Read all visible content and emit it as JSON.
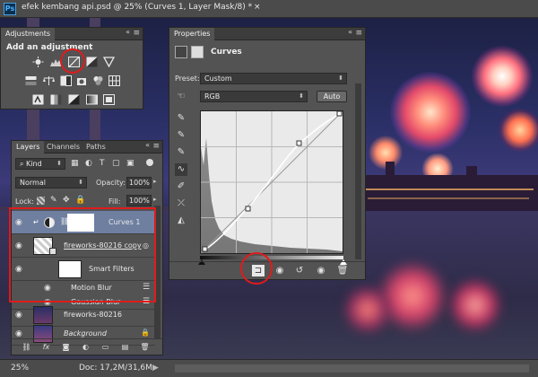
{
  "window": {
    "title": "efek kembang api.psd @ 25% (Curves 1, Layer Mask/8) *",
    "close_glyph": "×",
    "logo": "Ps"
  },
  "status_bar": {
    "zoom": "25%",
    "doc_info": "Doc: 17,2M/31,6M"
  },
  "adjustments_panel": {
    "tab_label": "Adjustments",
    "heading": "Add an adjustment",
    "icons_row1": [
      "brightness-contrast-icon",
      "levels-icon",
      "curves-icon",
      "exposure-icon",
      "vibrance-icon"
    ],
    "icons_row2": [
      "hue-saturation-icon",
      "color-balance-icon",
      "black-white-icon",
      "photo-filter-icon",
      "channel-mixer-icon",
      "color-lookup-icon"
    ],
    "icons_row3": [
      "invert-icon",
      "posterize-icon",
      "threshold-icon",
      "gradient-map-icon",
      "selective-color-icon"
    ]
  },
  "properties_panel": {
    "tab_label": "Properties",
    "title": "Curves",
    "preset_label": "Preset:",
    "preset_value": "Custom",
    "channel_value": "RGB",
    "auto_button": "Auto",
    "tools": [
      "on-image-adjust-icon",
      "sample-black-icon",
      "sample-gray-icon",
      "sample-white-icon",
      "curve-edit-icon",
      "pencil-draw-icon",
      "smooth-icon",
      "clipping-warning-icon"
    ],
    "footer_icons": [
      "clip-to-layer-icon",
      "view-previous-icon",
      "reset-icon",
      "visibility-icon",
      "delete-icon"
    ]
  },
  "layers_panel": {
    "tabs": [
      "Layers",
      "Channels",
      "Paths"
    ],
    "filter_value": "Kind",
    "blend_mode": "Normal",
    "opacity_label": "Opacity:",
    "opacity_value": "100%",
    "lock_label": "Lock:",
    "fill_label": "Fill:",
    "fill_value": "100%",
    "layers": [
      {
        "name": "Curves 1",
        "selected": true,
        "kind": "adjustment"
      },
      {
        "name": "fireworks-80216 copy",
        "selected": false,
        "kind": "smart-object"
      },
      {
        "name": "Smart Filters",
        "selected": false,
        "kind": "smart-filters"
      },
      {
        "name": "Motion Blur",
        "selected": false,
        "kind": "filter"
      },
      {
        "name": "Gaussian Blur",
        "selected": false,
        "kind": "filter"
      },
      {
        "name": "fireworks-80216",
        "selected": false,
        "kind": "pixel"
      },
      {
        "name": "Background",
        "selected": false,
        "kind": "background"
      }
    ],
    "footer_icons": [
      "link-layers-icon",
      "fx-icon",
      "add-mask-icon",
      "new-fill-adjustment-icon",
      "new-group-icon",
      "new-layer-icon",
      "delete-layer-icon"
    ]
  },
  "colors": {
    "panel_bg": "#535353",
    "selection": "#6f7fa0",
    "annotation_red": "#e01b1b"
  }
}
